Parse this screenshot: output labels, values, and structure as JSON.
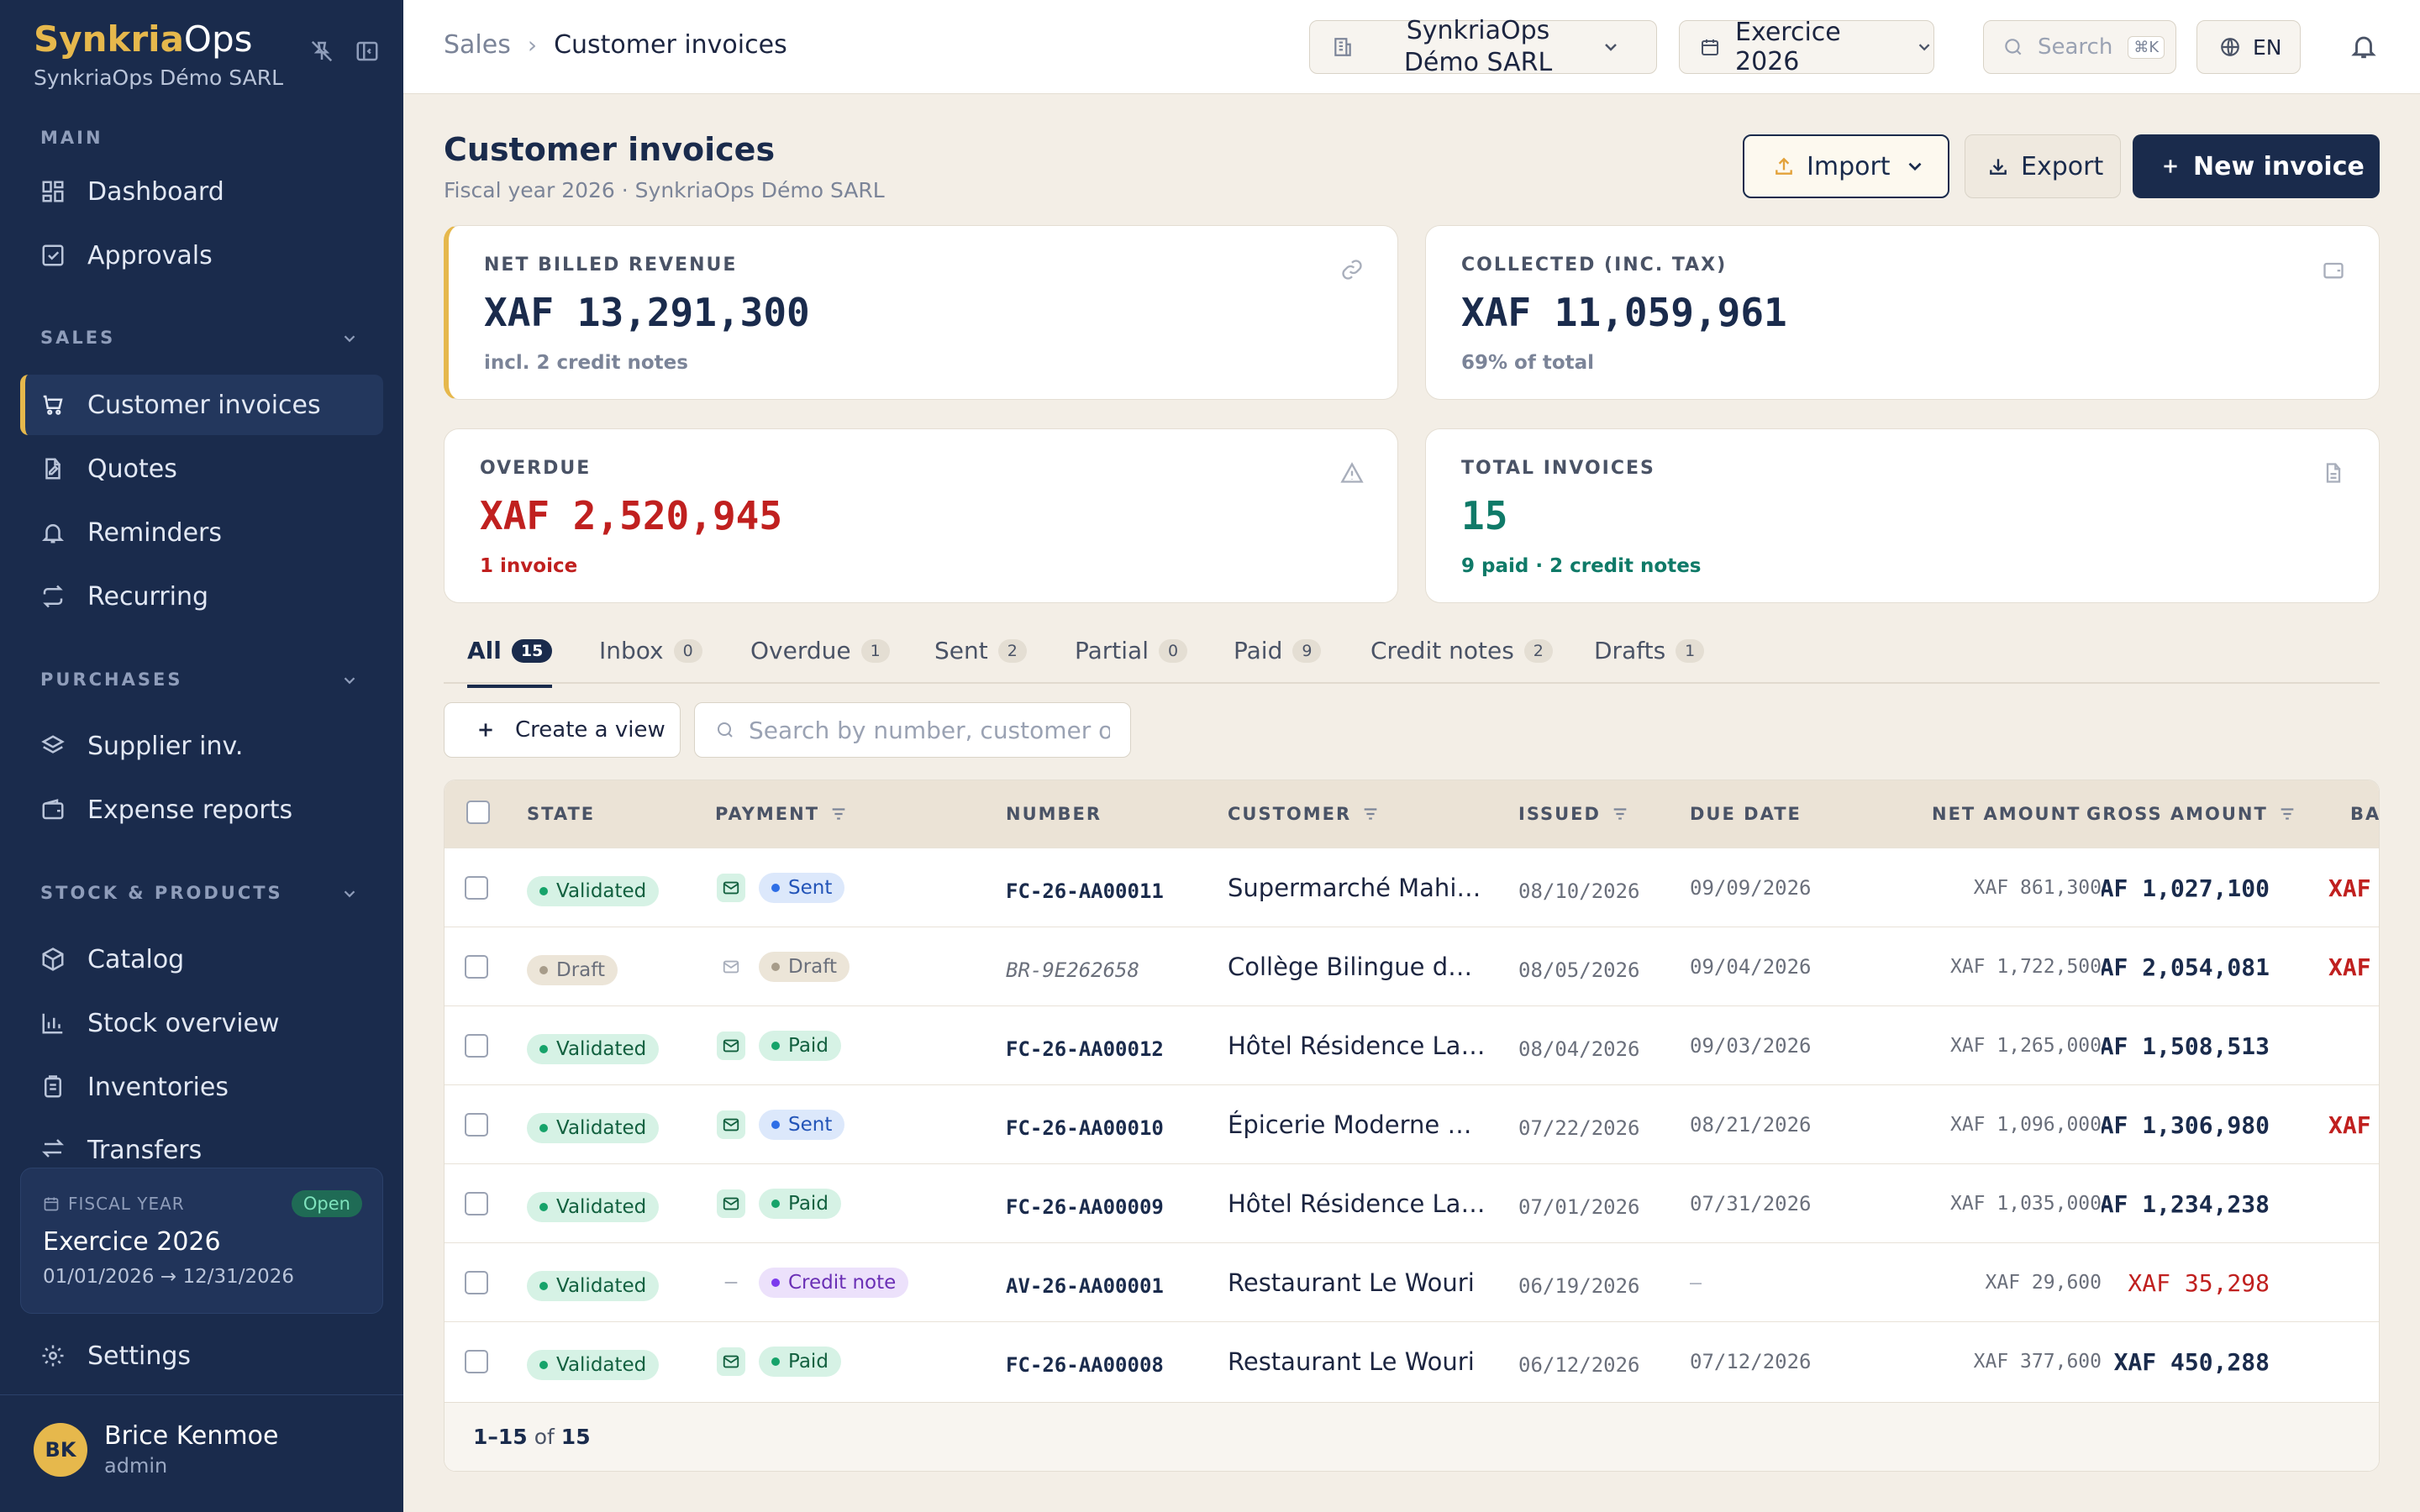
{
  "brand": {
    "name_a": "Synkria",
    "name_b": "Ops",
    "company": "SynkriaOps Démo SARL"
  },
  "sidebar": {
    "sections": {
      "main": "MAIN",
      "sales": "SALES",
      "purchases": "PURCHASES",
      "stock": "STOCK & PRODUCTS"
    },
    "items": [
      {
        "label": "Dashboard",
        "icon": "grid-icon"
      },
      {
        "label": "Approvals",
        "icon": "check-square-icon"
      },
      {
        "label": "Customer invoices",
        "icon": "cart-icon"
      },
      {
        "label": "Quotes",
        "icon": "document-edit-icon"
      },
      {
        "label": "Reminders",
        "icon": "bell-icon"
      },
      {
        "label": "Recurring",
        "icon": "repeat-icon"
      },
      {
        "label": "Supplier inv.",
        "icon": "layers-icon"
      },
      {
        "label": "Expense reports",
        "icon": "wallet-icon"
      },
      {
        "label": "Catalog",
        "icon": "box-icon"
      },
      {
        "label": "Stock overview",
        "icon": "bar-chart-icon"
      },
      {
        "label": "Inventories",
        "icon": "clipboard-icon"
      },
      {
        "label": "Transfers",
        "icon": "arrows-icon"
      },
      {
        "label": "Settings",
        "icon": "gear-icon"
      }
    ],
    "fiscal": {
      "label": "FISCAL YEAR",
      "status": "Open",
      "name": "Exercice 2026",
      "dates": "01/01/2026 → 12/31/2026"
    },
    "user": {
      "initials": "BK",
      "name": "Brice Kenmoe",
      "role": "admin"
    }
  },
  "topbar": {
    "breadcrumb_parent": "Sales",
    "breadcrumb_current": "Customer invoices",
    "company_select": "SynkriaOps Démo SARL",
    "year_select": "Exercice 2026",
    "search_label": "Search",
    "search_shortcut": "⌘K",
    "lang": "EN"
  },
  "page": {
    "title": "Customer invoices",
    "subtitle": "Fiscal year 2026 · SynkriaOps Démo SARL",
    "import_label": "Import",
    "export_label": "Export",
    "new_label": "New invoice"
  },
  "cards": {
    "net": {
      "title": "NET BILLED REVENUE",
      "value": "XAF 13,291,300",
      "sub": "incl. 2 credit notes"
    },
    "collected": {
      "title": "COLLECTED (INC. TAX)",
      "value": "XAF 11,059,961",
      "sub": "69% of total"
    },
    "overdue": {
      "title": "OVERDUE",
      "value": "XAF 2,520,945",
      "sub": "1 invoice"
    },
    "total": {
      "title": "TOTAL INVOICES",
      "value": "15",
      "sub": "9 paid · 2 credit notes"
    }
  },
  "colors": {
    "navy": "#1a2b4c",
    "gold": "#e6b84c",
    "red": "#c0201f",
    "teal": "#0f7a68"
  },
  "tabs": [
    {
      "label": "All",
      "count": "15"
    },
    {
      "label": "Inbox",
      "count": "0"
    },
    {
      "label": "Overdue",
      "count": "1"
    },
    {
      "label": "Sent",
      "count": "2"
    },
    {
      "label": "Partial",
      "count": "0"
    },
    {
      "label": "Paid",
      "count": "9"
    },
    {
      "label": "Credit notes",
      "count": "2"
    },
    {
      "label": "Drafts",
      "count": "1"
    }
  ],
  "toolbar": {
    "create_view": "Create a view",
    "search_placeholder": "Search by number, customer or s"
  },
  "table": {
    "headers": {
      "state": "STATE",
      "payment": "PAYMENT",
      "number": "NUMBER",
      "customer": "CUSTOMER",
      "issued": "ISSUED",
      "due": "DUE DATE",
      "net": "NET AMOUNT",
      "gross": "GROSS AMOUNT",
      "balance": "BA"
    },
    "rows": [
      {
        "state": "Validated",
        "payment": "Sent",
        "number": "FC-26-AA00011",
        "customer": "Supermarché Mahi…",
        "issued": "08/10/2026",
        "due": "09/09/2026",
        "net": "XAF 861,300",
        "gross": "XAF 1,027,100",
        "balance": "XAF"
      },
      {
        "state": "Draft",
        "payment": "Draft",
        "number": "BR-9E262658",
        "customer": "Collège Bilingue d…",
        "issued": "08/05/2026",
        "due": "09/04/2026",
        "net": "XAF 1,722,500",
        "gross": "XAF 2,054,081",
        "balance": "XAF"
      },
      {
        "state": "Validated",
        "payment": "Paid",
        "number": "FC-26-AA00012",
        "customer": "Hôtel Résidence La…",
        "issued": "08/04/2026",
        "due": "09/03/2026",
        "net": "XAF 1,265,000",
        "gross": "XAF 1,508,513",
        "balance": ""
      },
      {
        "state": "Validated",
        "payment": "Sent",
        "number": "FC-26-AA00010",
        "customer": "Épicerie Moderne …",
        "issued": "07/22/2026",
        "due": "08/21/2026",
        "net": "XAF 1,096,000",
        "gross": "XAF 1,306,980",
        "balance": "XAF"
      },
      {
        "state": "Validated",
        "payment": "Paid",
        "number": "FC-26-AA00009",
        "customer": "Hôtel Résidence La…",
        "issued": "07/01/2026",
        "due": "07/31/2026",
        "net": "XAF 1,035,000",
        "gross": "XAF 1,234,238",
        "balance": ""
      },
      {
        "state": "Validated",
        "payment": "Credit note",
        "number": "AV-26-AA00001",
        "customer": "Restaurant Le Wouri",
        "issued": "06/19/2026",
        "due": "–",
        "net": "XAF 29,600",
        "gross": "XAF 35,298",
        "balance": ""
      },
      {
        "state": "Validated",
        "payment": "Paid",
        "number": "FC-26-AA00008",
        "customer": "Restaurant Le Wouri",
        "issued": "06/12/2026",
        "due": "07/12/2026",
        "net": "XAF 377,600",
        "gross": "XAF 450,288",
        "balance": ""
      }
    ],
    "pagination": {
      "range": "1–15",
      "of": "of",
      "total": "15"
    }
  }
}
